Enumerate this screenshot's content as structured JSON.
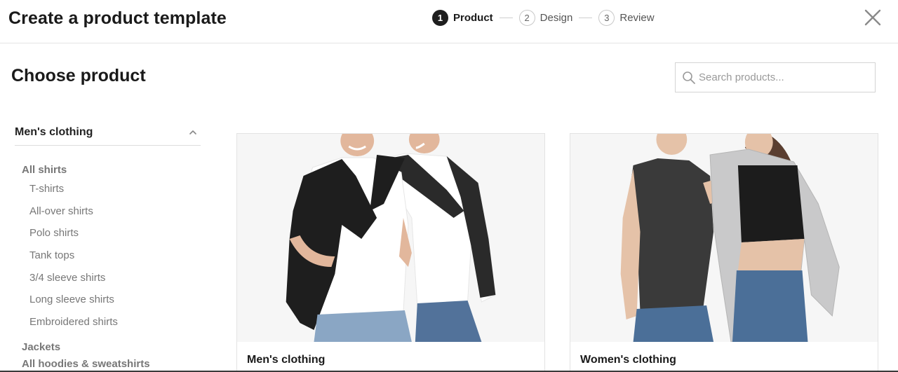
{
  "header": {
    "title": "Create a product template",
    "steps": [
      {
        "num": "1",
        "label": "Product",
        "active": true
      },
      {
        "num": "2",
        "label": "Design",
        "active": false
      },
      {
        "num": "3",
        "label": "Review",
        "active": false
      }
    ],
    "close_icon": "close-icon"
  },
  "main": {
    "title": "Choose product",
    "search": {
      "placeholder": "Search products...",
      "value": "",
      "icon": "search-icon"
    }
  },
  "sidebar": {
    "category": {
      "label": "Men's clothing",
      "icon": "chevron-up-icon",
      "expanded": true
    },
    "groups": [
      {
        "label": "All shirts",
        "items": [
          "T-shirts",
          "All-over shirts",
          "Polo shirts",
          "Tank tops",
          "3/4 sleeve shirts",
          "Long sleeve shirts",
          "Embroidered shirts"
        ]
      },
      {
        "label": "Jackets",
        "items": []
      },
      {
        "label": "All hoodies & sweatshirts",
        "items": []
      }
    ]
  },
  "products": [
    {
      "label": "Men's clothing",
      "image": "men-clothing-photo"
    },
    {
      "label": "Women's clothing",
      "image": "women-clothing-photo"
    }
  ],
  "colors": {
    "accent": "#1e1e1e",
    "text_muted": "#777777",
    "border": "#e3e3e3",
    "card_bg": "#f6f6f6"
  }
}
